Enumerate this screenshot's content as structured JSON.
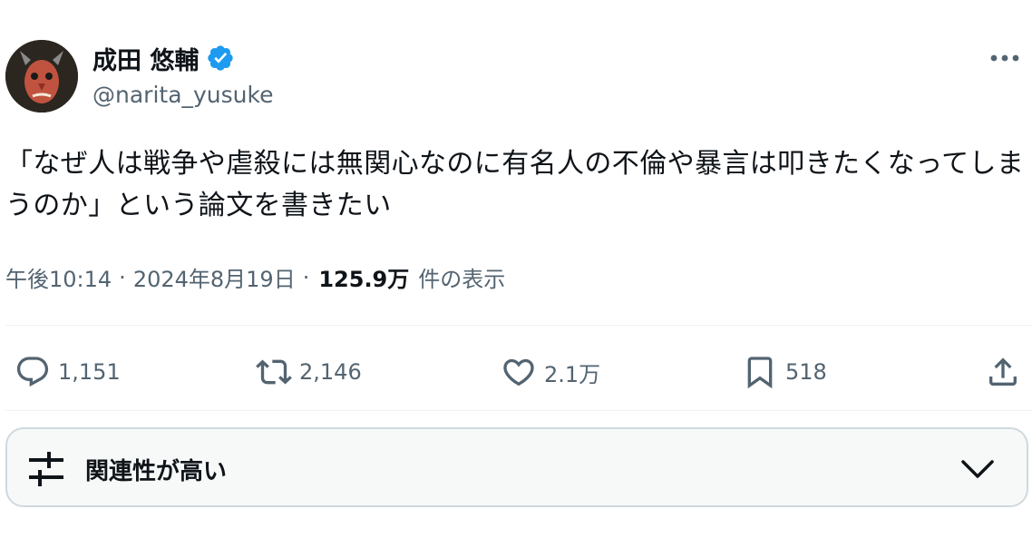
{
  "author": {
    "display_name": "成田 悠輔",
    "handle": "@narita_yusuke",
    "verified": true
  },
  "tweet": {
    "text": "「なぜ人は戦争や虐殺には無関心なのに有名人の不倫や暴言は叩きたくなってしまうのか」という論文を書きたい",
    "time": "午後10:14",
    "separator": "·",
    "date": "2024年8月19日",
    "views_count": "125.9万",
    "views_label": "件の表示"
  },
  "actions": {
    "replies": "1,151",
    "reposts": "2,146",
    "likes": "2.1万",
    "bookmarks": "518"
  },
  "sort": {
    "label": "関連性が高い"
  },
  "colors": {
    "text_primary": "#0f1419",
    "text_secondary": "#536471",
    "verified_blue": "#1d9bf0",
    "border": "#cfd9de",
    "divider": "#eff3f4"
  }
}
